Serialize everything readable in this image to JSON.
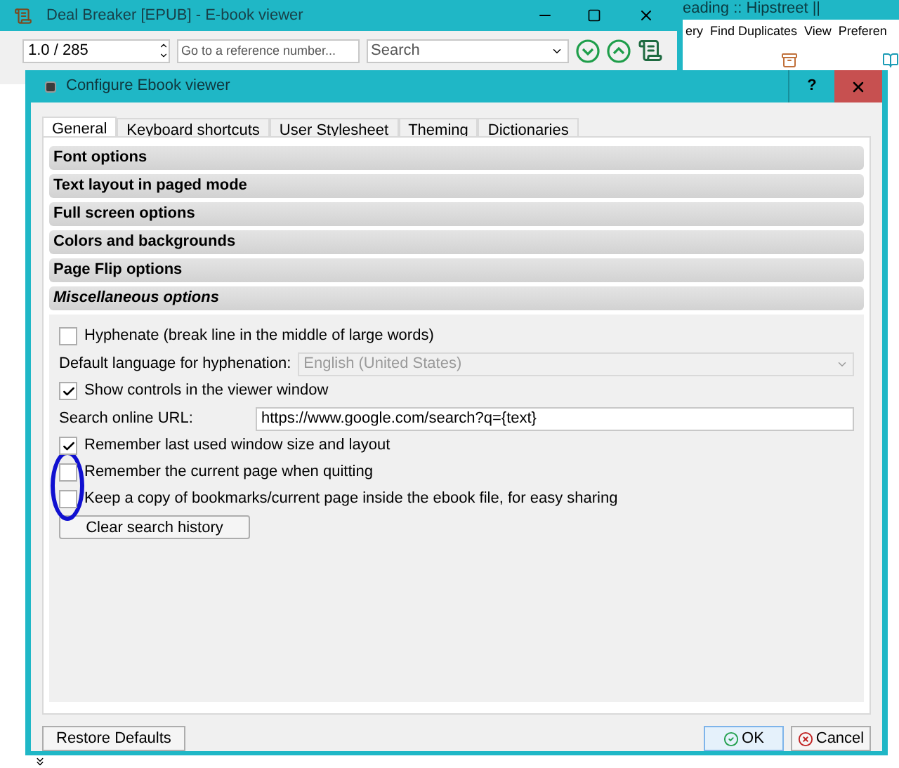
{
  "other_window": {
    "title": "eading :: Hipstreet ||",
    "menu": [
      "ery",
      "Find Duplicates",
      "View",
      "Preferen"
    ]
  },
  "viewer": {
    "title": "Deal Breaker [EPUB] - E-book viewer",
    "page": "1.0 / 285",
    "reference": {
      "placeholder": "Go to a reference number..."
    },
    "search": {
      "placeholder": "Search"
    }
  },
  "dialog": {
    "title": "Configure Ebook viewer",
    "help": "?",
    "tabs": [
      {
        "label": "General",
        "selected": true
      },
      {
        "label": "Keyboard shortcuts",
        "selected": false
      },
      {
        "label": "User Stylesheet",
        "selected": false
      },
      {
        "label": "Theming",
        "selected": false
      },
      {
        "label": "Dictionaries",
        "selected": false
      }
    ],
    "sections": [
      {
        "label": "Font options",
        "expanded": false
      },
      {
        "label": "Text layout in paged mode",
        "expanded": false
      },
      {
        "label": "Full screen options",
        "expanded": false
      },
      {
        "label": "Colors and backgrounds",
        "expanded": false
      },
      {
        "label": "Page Flip options",
        "expanded": false
      },
      {
        "label": "Miscellaneous options",
        "expanded": true
      }
    ],
    "options": [
      {
        "kind": "checkbox",
        "label": "Hyphenate (break line in the middle of large words)",
        "checked": false
      },
      {
        "kind": "select",
        "label": "Default language for hyphenation:",
        "value": "English (United States)",
        "disabled": true
      },
      {
        "kind": "checkbox",
        "label": "Show controls in the viewer window",
        "checked": true
      },
      {
        "kind": "text",
        "label": "Search online URL:",
        "value": "https://www.google.com/search?q={text}"
      },
      {
        "kind": "checkbox",
        "label": "Remember last used window size and layout",
        "checked": true
      },
      {
        "kind": "checkbox",
        "label": "Remember the current page when quitting",
        "checked": false
      },
      {
        "kind": "checkbox",
        "label": "Keep a copy of bookmarks/current page inside the ebook file, for easy sharing",
        "checked": false
      },
      {
        "kind": "button",
        "label": "Clear search history"
      }
    ],
    "restore": "Restore Defaults",
    "ok": "OK",
    "cancel": "Cancel"
  }
}
